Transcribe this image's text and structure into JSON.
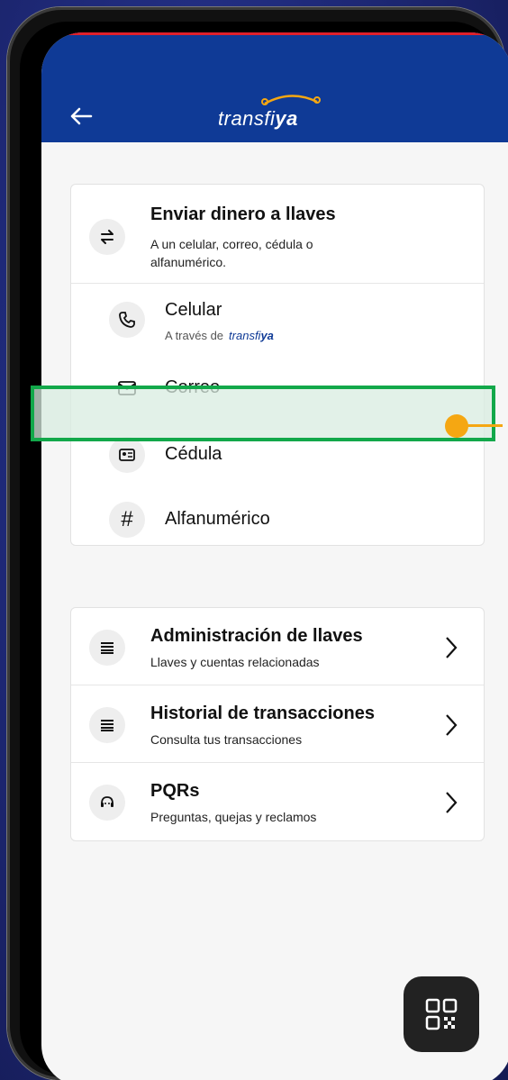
{
  "header": {
    "logo": {
      "prefix": "transfi",
      "suffix": "ya"
    },
    "back_icon": "arrow-left-icon"
  },
  "send_card": {
    "title": "Enviar dinero a llaves",
    "subtitle": "A un celular, correo, cédula o alfanumérico.",
    "icon": "swap-arrows-icon",
    "options": [
      {
        "label": "Celular",
        "subtitle": "A través de",
        "subtitle_logo_prefix": "transfi",
        "subtitle_logo_suffix": "ya",
        "icon": "phone-icon"
      },
      {
        "label": "Correo",
        "icon": "mail-icon"
      },
      {
        "label": "Cédula",
        "icon": "id-card-icon",
        "highlighted": true
      },
      {
        "label": "Alfanumérico",
        "icon": "hash-icon"
      }
    ]
  },
  "menu": [
    {
      "title": "Administración de llaves",
      "subtitle": "Llaves y cuentas relacionadas",
      "icon": "stack-icon"
    },
    {
      "title": "Historial de transacciones",
      "subtitle": "Consulta tus transacciones",
      "icon": "stack-icon"
    },
    {
      "title": "PQRs",
      "subtitle": "Preguntas, quejas y reclamos",
      "icon": "support-icon"
    }
  ],
  "colors": {
    "header_bg": "#0f3a96",
    "highlight_border": "#12a84a",
    "callout": "#f5a712",
    "qr_bg": "#222222"
  },
  "fab": {
    "icon": "qr-code-icon"
  }
}
